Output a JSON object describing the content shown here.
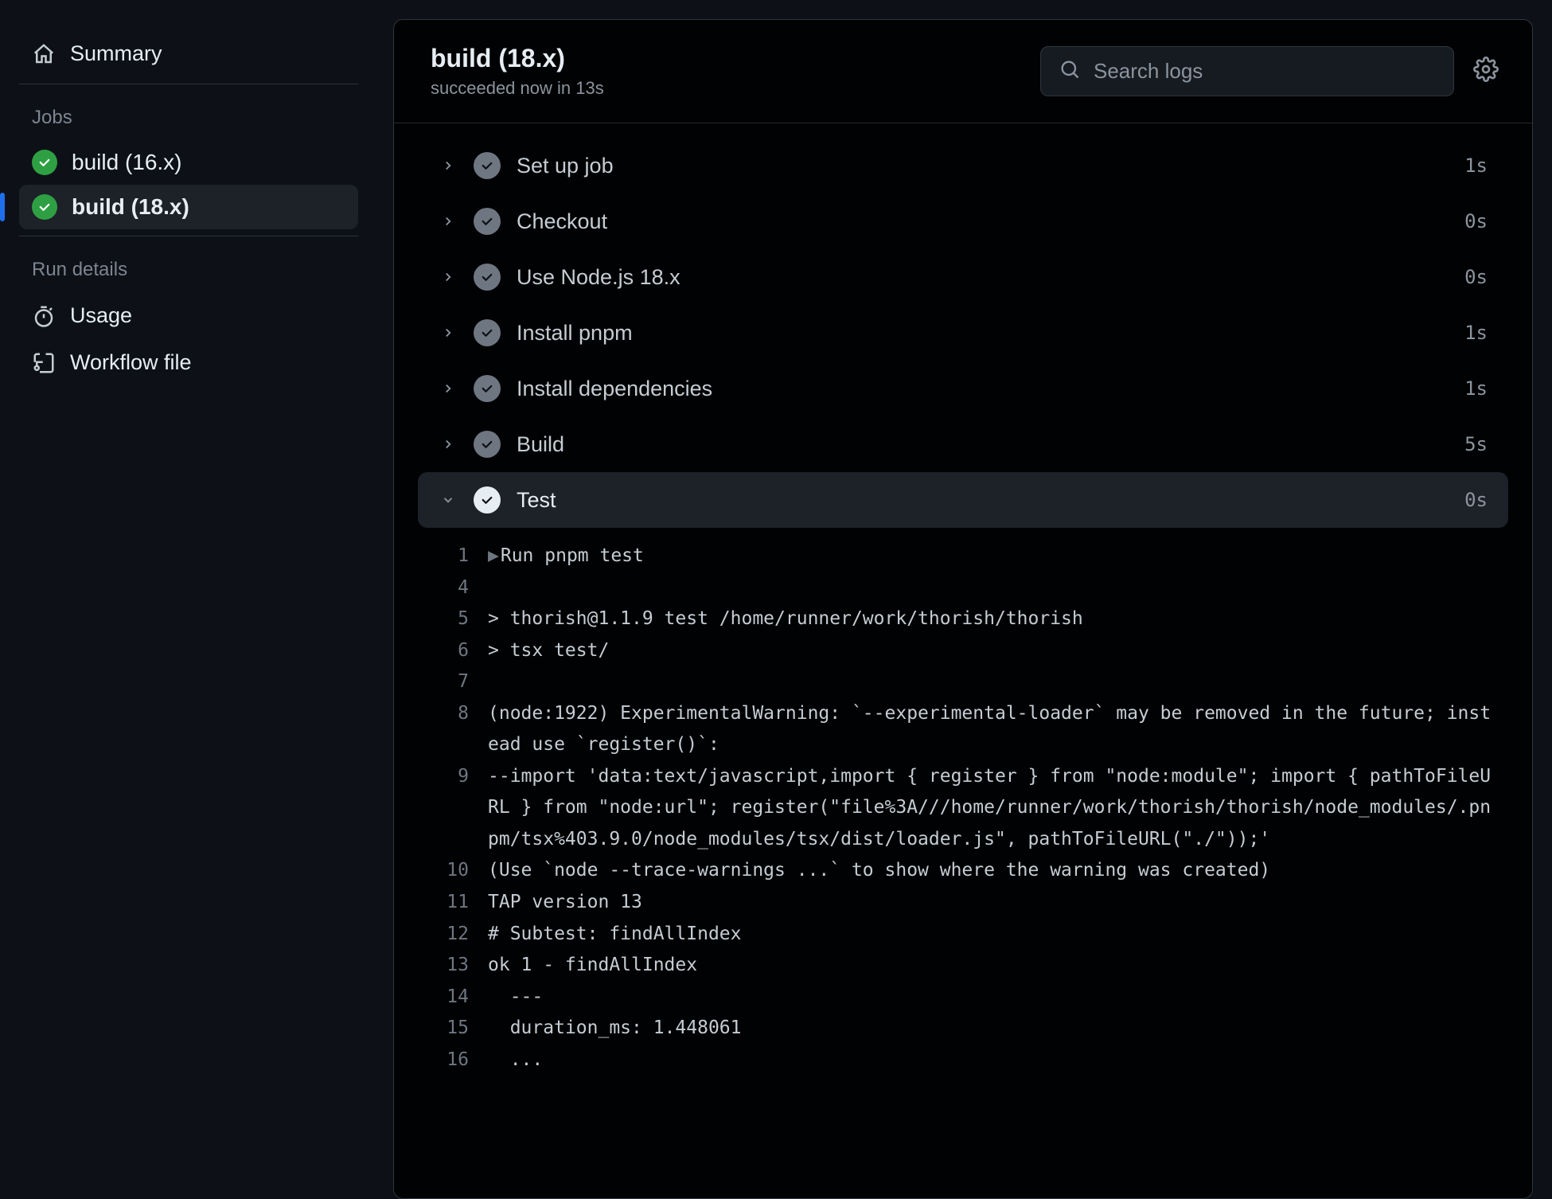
{
  "sidebar": {
    "summary_label": "Summary",
    "jobs_heading": "Jobs",
    "jobs": [
      {
        "label": "build (16.x)",
        "status": "success",
        "selected": false
      },
      {
        "label": "build (18.x)",
        "status": "success",
        "selected": true
      }
    ],
    "details_heading": "Run details",
    "details": [
      {
        "label": "Usage",
        "icon": "stopwatch"
      },
      {
        "label": "Workflow file",
        "icon": "workflow"
      }
    ]
  },
  "header": {
    "title": "build (18.x)",
    "subtitle": "succeeded now in 13s",
    "search_placeholder": "Search logs"
  },
  "steps": [
    {
      "name": "Set up job",
      "time": "1s",
      "expanded": false
    },
    {
      "name": "Checkout",
      "time": "0s",
      "expanded": false
    },
    {
      "name": "Use Node.js 18.x",
      "time": "0s",
      "expanded": false
    },
    {
      "name": "Install pnpm",
      "time": "1s",
      "expanded": false
    },
    {
      "name": "Install dependencies",
      "time": "1s",
      "expanded": false
    },
    {
      "name": "Build",
      "time": "5s",
      "expanded": false
    },
    {
      "name": "Test",
      "time": "0s",
      "expanded": true
    }
  ],
  "log": [
    {
      "n": "1",
      "caret": true,
      "text": "Run pnpm test"
    },
    {
      "n": "4",
      "caret": false,
      "text": ""
    },
    {
      "n": "5",
      "caret": false,
      "text": "> thorish@1.1.9 test /home/runner/work/thorish/thorish"
    },
    {
      "n": "6",
      "caret": false,
      "text": "> tsx test/"
    },
    {
      "n": "7",
      "caret": false,
      "text": ""
    },
    {
      "n": "8",
      "caret": false,
      "text": "(node:1922) ExperimentalWarning: `--experimental-loader` may be removed in the future; instead use `register()`:"
    },
    {
      "n": "9",
      "caret": false,
      "text": "--import 'data:text/javascript,import { register } from \"node:module\"; import { pathToFileURL } from \"node:url\"; register(\"file%3A///home/runner/work/thorish/thorish/node_modules/.pnpm/tsx%403.9.0/node_modules/tsx/dist/loader.js\", pathToFileURL(\"./\"));'"
    },
    {
      "n": "10",
      "caret": false,
      "text": "(Use `node --trace-warnings ...` to show where the warning was created)"
    },
    {
      "n": "11",
      "caret": false,
      "text": "TAP version 13"
    },
    {
      "n": "12",
      "caret": false,
      "text": "# Subtest: findAllIndex"
    },
    {
      "n": "13",
      "caret": false,
      "text": "ok 1 - findAllIndex"
    },
    {
      "n": "14",
      "caret": false,
      "text": "  ---"
    },
    {
      "n": "15",
      "caret": false,
      "text": "  duration_ms: 1.448061"
    },
    {
      "n": "16",
      "caret": false,
      "text": "  ..."
    }
  ]
}
